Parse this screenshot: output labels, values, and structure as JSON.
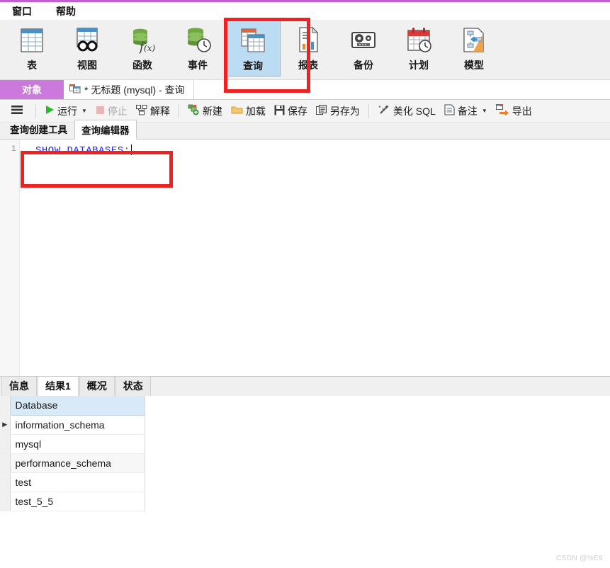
{
  "menubar": {
    "items": [
      {
        "label": "窗口",
        "name": "menu-window"
      },
      {
        "label": "帮助",
        "name": "menu-help"
      }
    ]
  },
  "ribbon": {
    "buttons": [
      {
        "label": "表",
        "icon": "table-icon",
        "selected": false
      },
      {
        "label": "视图",
        "icon": "view-icon",
        "selected": false
      },
      {
        "label": "函数",
        "icon": "function-icon",
        "selected": false
      },
      {
        "label": "事件",
        "icon": "event-icon",
        "selected": false
      },
      {
        "label": "查询",
        "icon": "query-icon",
        "selected": true
      },
      {
        "label": "报表",
        "icon": "report-icon",
        "selected": false
      },
      {
        "label": "备份",
        "icon": "backup-icon",
        "selected": false
      },
      {
        "label": "计划",
        "icon": "schedule-icon",
        "selected": false
      },
      {
        "label": "模型",
        "icon": "model-icon",
        "selected": false
      }
    ]
  },
  "tabstrip": {
    "object_label": "对象",
    "doc_tab": "* 无标题 (mysql) - 查询",
    "doc_icon": "query-tab-icon"
  },
  "query_toolbar": {
    "menu_icon": "hamburger-icon",
    "run": "运行",
    "stop": "停止",
    "explain": "解释",
    "new": "新建",
    "load": "加载",
    "save": "保存",
    "save_as": "另存为",
    "beautify": "美化 SQL",
    "note": "备注",
    "export": "导出"
  },
  "editor_tabs": [
    {
      "label": "查询创建工具",
      "active": false
    },
    {
      "label": "查询编辑器",
      "active": true
    }
  ],
  "editor": {
    "line_number": "1",
    "sql_keyword": "SHOW DATABASES",
    "sql_terminator": ";"
  },
  "result_tabs": [
    {
      "label": "信息",
      "active": false
    },
    {
      "label": "结果1",
      "active": true
    },
    {
      "label": "概况",
      "active": false
    },
    {
      "label": "状态",
      "active": false
    }
  ],
  "result_grid": {
    "columns": [
      "Database"
    ],
    "current_row_marker": "▶",
    "rows": [
      [
        "information_schema"
      ],
      [
        "mysql"
      ],
      [
        "performance_schema"
      ],
      [
        "test"
      ],
      [
        "test_5_5"
      ]
    ]
  },
  "watermark": "CSDN @%E9",
  "colors": {
    "accent_purple": "#c35bd1",
    "tab_object_bg": "#cc79dd",
    "selected_ribbon_bg": "#bcdcf4",
    "annotation_red": "#ee2222",
    "sql_keyword": "#2222ee",
    "grid_header_bg": "#d8eaf8"
  }
}
